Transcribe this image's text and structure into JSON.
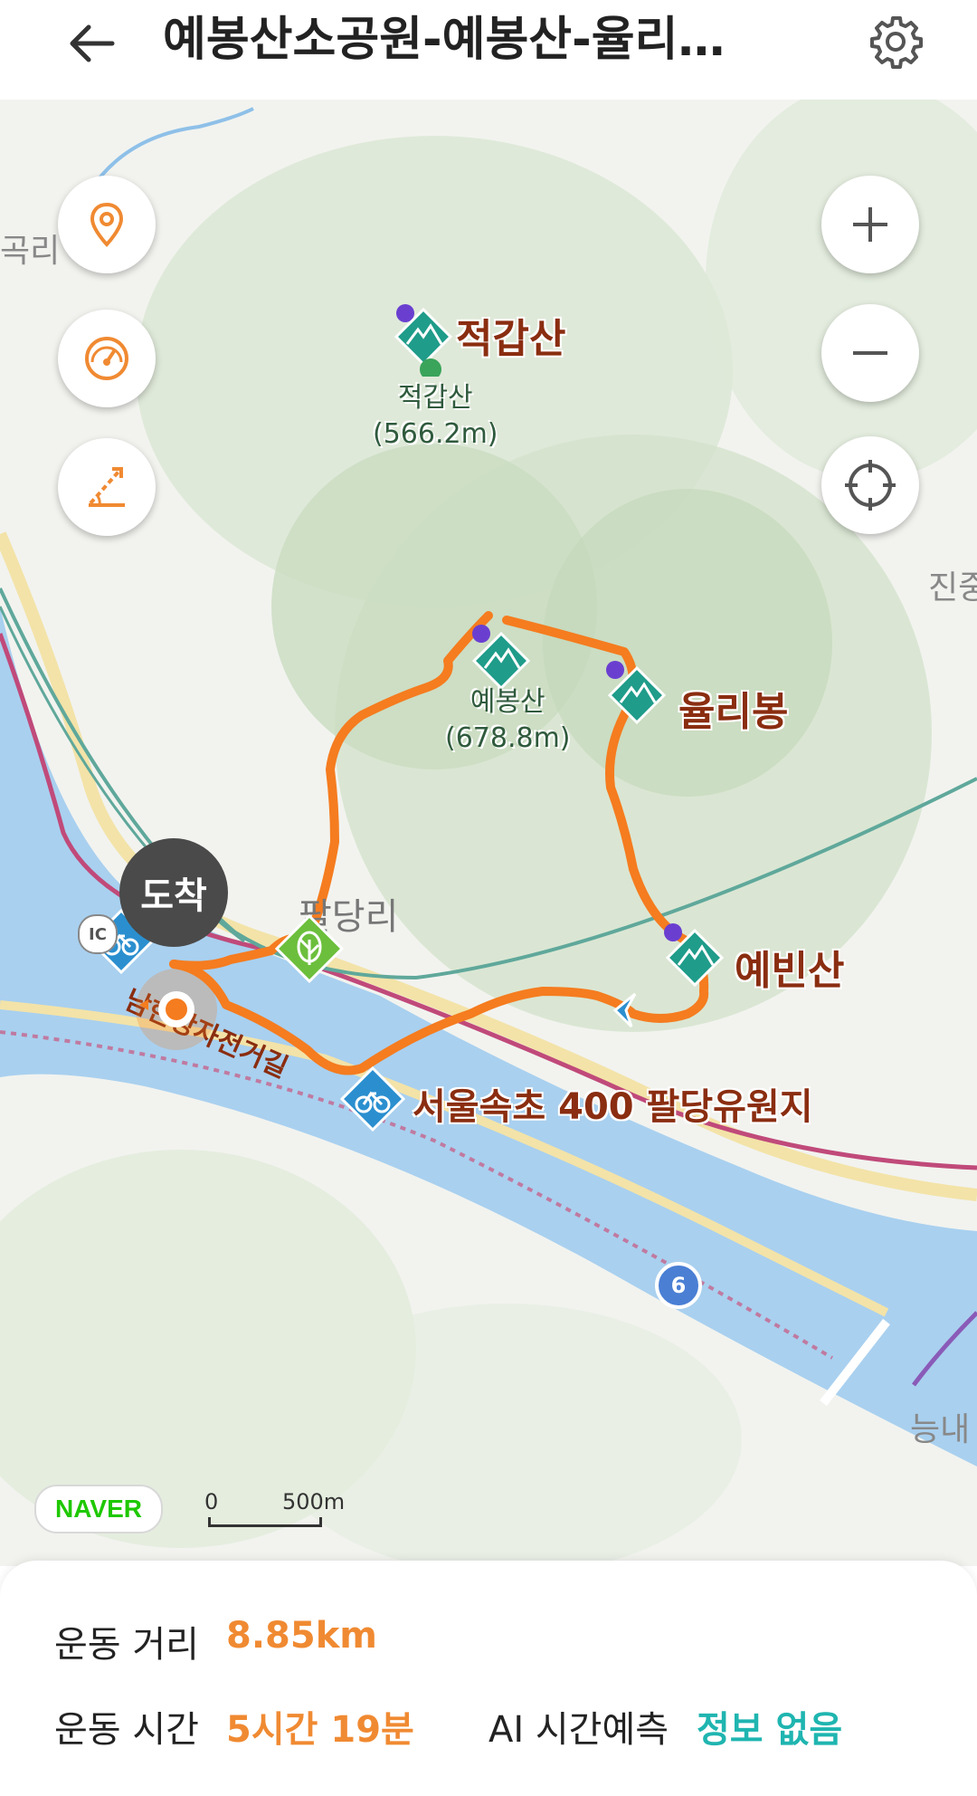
{
  "header": {
    "title": "예봉산소공원-예봉산-율리…"
  },
  "map": {
    "peaks": [
      {
        "name": "적갑산",
        "sub_name": "적갑산",
        "elevation": "(566.2m)"
      },
      {
        "name": "",
        "sub_name": "예봉산",
        "elevation": "(678.8m)"
      },
      {
        "name": "율리봉"
      },
      {
        "name": "예빈산"
      }
    ],
    "village_label": "팔당리",
    "bike_label": "서울속초 400 팔당유원지",
    "trail_label": "남한강자전거길",
    "edge_labels": {
      "left": "곡리",
      "right": "진중",
      "bottom_right": "능내"
    },
    "route_shield": "6",
    "ic_label": "IC",
    "arrival_label": "도착",
    "attribution": "NAVER",
    "scale": {
      "zero": "0",
      "distance": "500m"
    }
  },
  "controls": {
    "left": [
      "location-pin-icon",
      "speedometer-icon",
      "slope-icon"
    ],
    "right": [
      "zoom-in-icon",
      "zoom-out-icon",
      "crosshair-icon"
    ]
  },
  "stats": {
    "distance_label": "운동 거리",
    "distance_value": "8.85km",
    "time_label": "운동 시간",
    "time_value": "5시간 19분",
    "ai_label": "AI 시간예측",
    "ai_value": "정보 없음"
  },
  "colors": {
    "route": "#f57c1f",
    "accent_orange": "#f08a32",
    "accent_teal": "#1fb5b0",
    "water": "#a9d0ef",
    "peak_marker": "#1f9c8a"
  }
}
